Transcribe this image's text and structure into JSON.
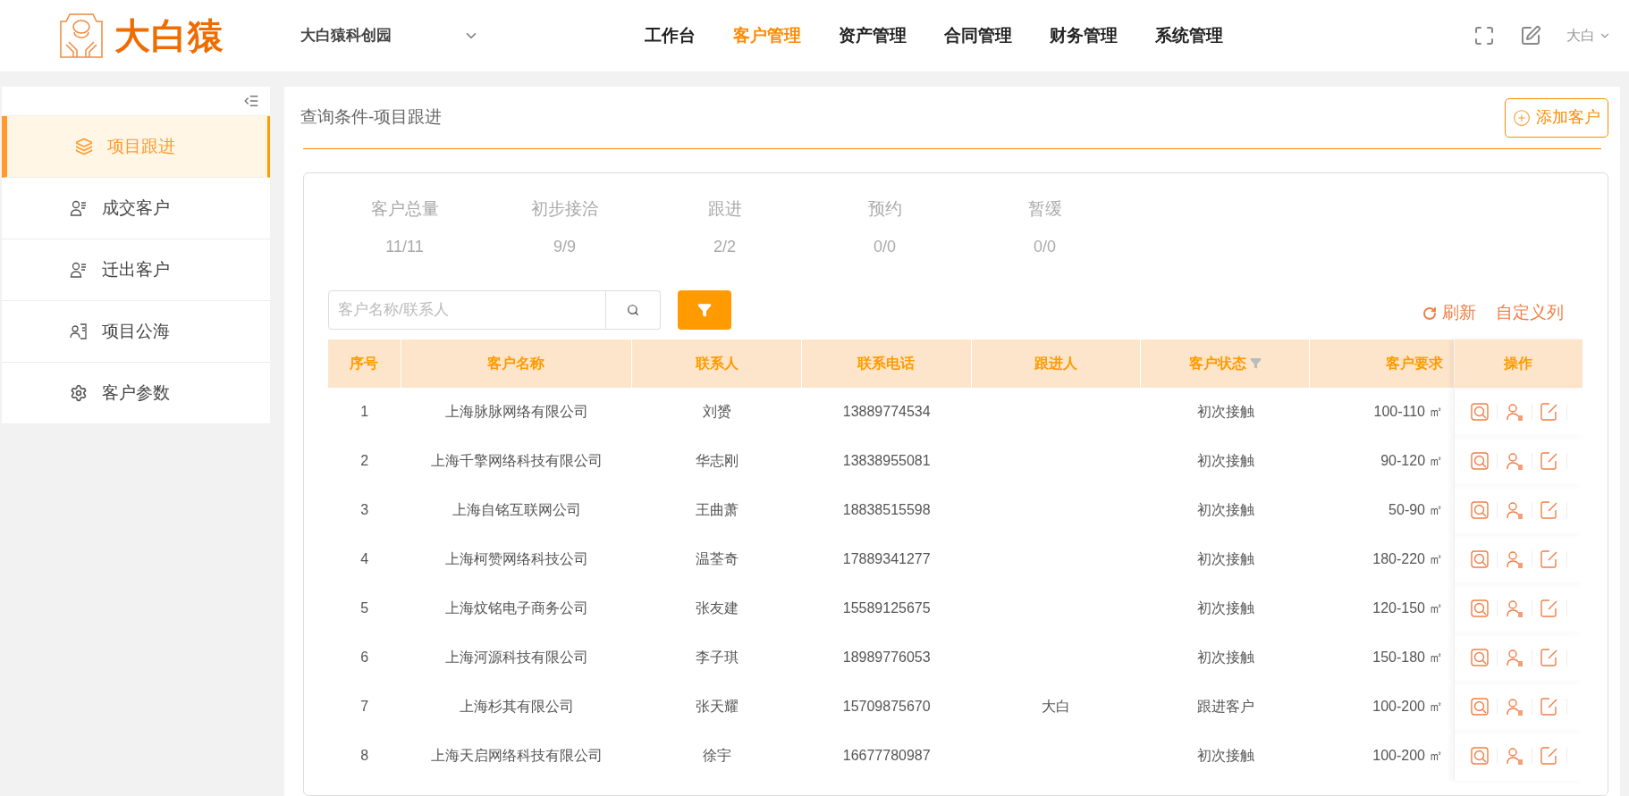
{
  "header": {
    "logo_text": "大白猿",
    "project": "大白猿科创园",
    "nav": [
      {
        "label": "工作台",
        "selected": false
      },
      {
        "label": "客户管理",
        "selected": true
      },
      {
        "label": "资产管理",
        "selected": false
      },
      {
        "label": "合同管理",
        "selected": false
      },
      {
        "label": "财务管理",
        "selected": false
      },
      {
        "label": "系统管理",
        "selected": false
      }
    ],
    "user": "大白"
  },
  "sidebar": {
    "items": [
      {
        "label": "项目跟进",
        "kind": "layers",
        "selected": true
      },
      {
        "label": "成交客户",
        "kind": "contacts",
        "selected": false
      },
      {
        "label": "迁出客户",
        "kind": "contacts",
        "selected": false
      },
      {
        "label": "项目公海",
        "kind": "pool",
        "selected": false
      },
      {
        "label": "客户参数",
        "kind": "params",
        "selected": false
      }
    ]
  },
  "page": {
    "title": "查询条件-项目跟进",
    "add_button": "添加客户"
  },
  "stats": [
    {
      "label": "客户总量",
      "value": "11/11"
    },
    {
      "label": "初步接洽",
      "value": "9/9"
    },
    {
      "label": "跟进",
      "value": "2/2"
    },
    {
      "label": "预约",
      "value": "0/0"
    },
    {
      "label": "暂缓",
      "value": "0/0"
    }
  ],
  "search": {
    "placeholder": "客户名称/联系人"
  },
  "toolbar": {
    "refresh": "刷新",
    "columns": "自定义列"
  },
  "table": {
    "columns": [
      {
        "label": "序号",
        "filter": false
      },
      {
        "label": "客户名称",
        "filter": false
      },
      {
        "label": "联系人",
        "filter": false
      },
      {
        "label": "联系电话",
        "filter": false
      },
      {
        "label": "跟进人",
        "filter": false
      },
      {
        "label": "客户状态",
        "filter": true
      },
      {
        "label": "客户要求",
        "filter": false
      },
      {
        "label": "操作",
        "filter": false
      }
    ],
    "rows": [
      [
        "1",
        "上海脉脉网络有限公司",
        "刘赟",
        "13889774534",
        "",
        "初次接触",
        "100-110 ㎡"
      ],
      [
        "2",
        "上海千擎网络科技有限公司",
        "华志刚",
        "13838955081",
        "",
        "初次接触",
        "90-120 ㎡"
      ],
      [
        "3",
        "上海自铭互联网公司",
        "王曲萧",
        "18838515598",
        "",
        "初次接触",
        "50-90 ㎡"
      ],
      [
        "4",
        "上海柯赞网络科技公司",
        "温荃奇",
        "17889341277",
        "",
        "初次接触",
        "180-220 ㎡"
      ],
      [
        "5",
        "上海炆铭电子商务公司",
        "张友建",
        "15589125675",
        "",
        "初次接触",
        "120-150 ㎡"
      ],
      [
        "6",
        "上海河源科技有限公司",
        "李子琪",
        "18989776053",
        "",
        "初次接触",
        "150-180 ㎡"
      ],
      [
        "7",
        "上海杉其有限公司",
        "张天耀",
        "15709875670",
        "大白",
        "跟进客户",
        "100-200 ㎡"
      ],
      [
        "8",
        "上海天启网络科技有限公司",
        "徐宇",
        "16677780987",
        "",
        "初次接触",
        "100-200 ㎡"
      ]
    ]
  }
}
